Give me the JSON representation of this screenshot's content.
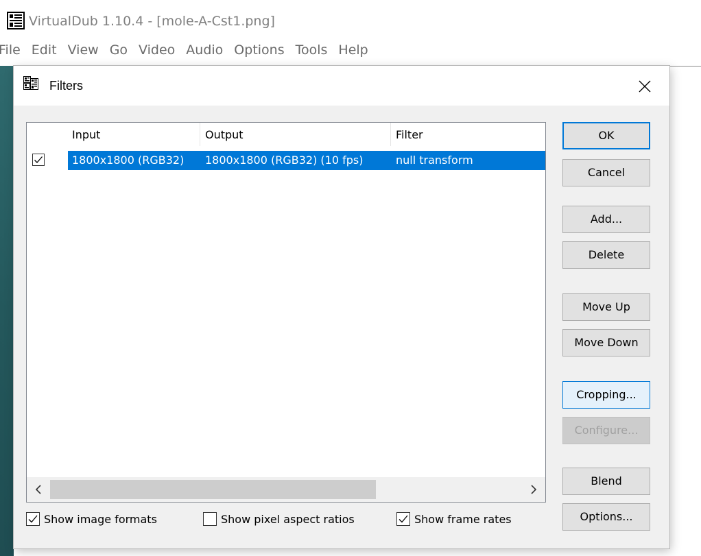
{
  "app": {
    "title": "VirtualDub 1.10.4 - [mole-A-Cst1.png]",
    "icon": "virtualdub-film-icon"
  },
  "menu": [
    "File",
    "Edit",
    "View",
    "Go",
    "Video",
    "Audio",
    "Options",
    "Tools",
    "Help"
  ],
  "dialog": {
    "title": "Filters",
    "icon": "filters-film-icon",
    "close_glyph": "✕"
  },
  "filter_list": {
    "columns": [
      "Input",
      "Output",
      "Filter"
    ],
    "rows": [
      {
        "checked": true,
        "selected": true,
        "input": "1800x1800 (RGB32)",
        "output": "1800x1800 (RGB32) (10 fps)",
        "filter": "null transform"
      }
    ],
    "scroll_left": "<",
    "scroll_right": ">"
  },
  "buttons": {
    "ok": "OK",
    "cancel": "Cancel",
    "add": "Add...",
    "delete": "Delete",
    "move_up": "Move Up",
    "move_down": "Move Down",
    "cropping": "Cropping...",
    "configure": "Configure...",
    "blend": "Blend",
    "options": "Options..."
  },
  "checkboxes": {
    "show_image_formats": {
      "label": "Show image formats",
      "checked": true
    },
    "show_pixel_aspect_ratios": {
      "label": "Show pixel aspect ratios",
      "checked": false
    },
    "show_frame_rates": {
      "label": "Show frame rates",
      "checked": true
    }
  },
  "colors": {
    "selection": "#0078d7",
    "desktop": "#2a5a5e",
    "dialog_bg": "#f0f0f0"
  }
}
